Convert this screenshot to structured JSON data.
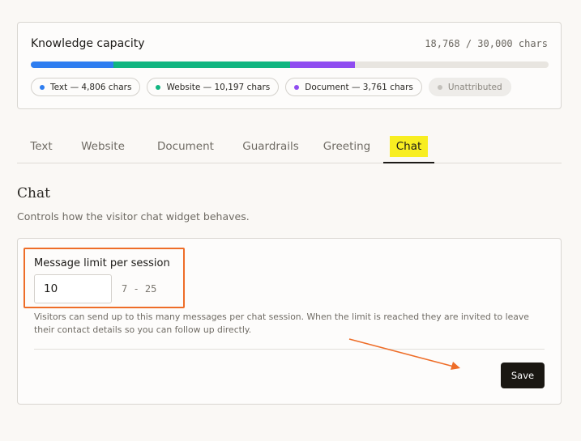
{
  "capacity": {
    "title": "Knowledge capacity",
    "used": 18768,
    "total": 30000,
    "count_text": "18,768 / 30,000 chars",
    "segments": [
      {
        "name": "text",
        "value": 4806,
        "color": "#2e7df0"
      },
      {
        "name": "website",
        "value": 10197,
        "color": "#11b580"
      },
      {
        "name": "document",
        "value": 3761,
        "color": "#8f4cf0"
      }
    ],
    "chips": [
      {
        "label": "Text — 4,806 chars",
        "color": "#2e7df0"
      },
      {
        "label": "Website — 10,197 chars",
        "color": "#11b580"
      },
      {
        "label": "Document — 3,761 chars",
        "color": "#8f4cf0"
      },
      {
        "label": "Unattributed",
        "color": "#c4c1bc"
      }
    ]
  },
  "tabs": [
    {
      "label": "Text"
    },
    {
      "label": "Website"
    },
    {
      "label": "Document"
    },
    {
      "label": "Guardrails"
    },
    {
      "label": "Greeting"
    },
    {
      "label": "Chat",
      "active": true
    }
  ],
  "section": {
    "title": "Chat",
    "description": "Controls how the visitor chat widget behaves."
  },
  "message_limit": {
    "label": "Message limit per session",
    "value": "10",
    "range": "7 - 25",
    "help": "Visitors can send up to this many messages per chat session. When the limit is reached they are invited to leave their contact details so you can follow up directly."
  },
  "actions": {
    "save_label": "Save"
  },
  "colors": {
    "annotation": "#ee6d28",
    "tab_highlight": "#f8ee21",
    "primary_button": "#1a1712"
  }
}
